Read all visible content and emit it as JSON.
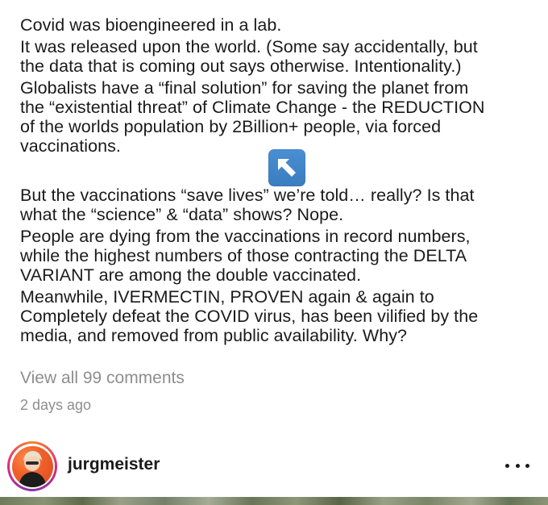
{
  "caption": {
    "paragraphs": [
      [
        "Covid was bioengineered in a lab."
      ],
      [
        "It was released upon the world. (Some say accidentally, but",
        "the data that is coming out says otherwise. Intentionality.)"
      ],
      [
        "Globalists have a “final solution” for saving the planet from",
        "the “existential threat” of Climate Change - the REDUCTION",
        "of the worlds population by 2Billion+ people, via forced",
        "vaccinations."
      ],
      [
        "But the vaccinations “save lives” we’re told… really? Is that",
        "what the “science” & “data” shows? Nope."
      ],
      [
        "People are dying from the vaccinations in record numbers,",
        "while the highest numbers of those contracting the DELTA",
        "VARIANT are among the double vaccinated."
      ],
      [
        "Meanwhile, IVERMECTIN, PROVEN again & again to",
        "Completely defeat the COVID virus, has been vilified by the",
        "media, and removed from public availability. Why?"
      ]
    ],
    "emoji": "up-left-arrow-emoji"
  },
  "comments": {
    "view_all_label": "View all 99 comments"
  },
  "timestamp": "2 days ago",
  "next_post": {
    "username": "jurgmeister",
    "avatar": "user-avatar",
    "more_icon": "more-options-icon"
  },
  "colors": {
    "text": "#1a1a1a",
    "muted": "#8e8e8e",
    "emoji_blue": "#4a8fd3",
    "story_ring": "#dd2a7b"
  }
}
